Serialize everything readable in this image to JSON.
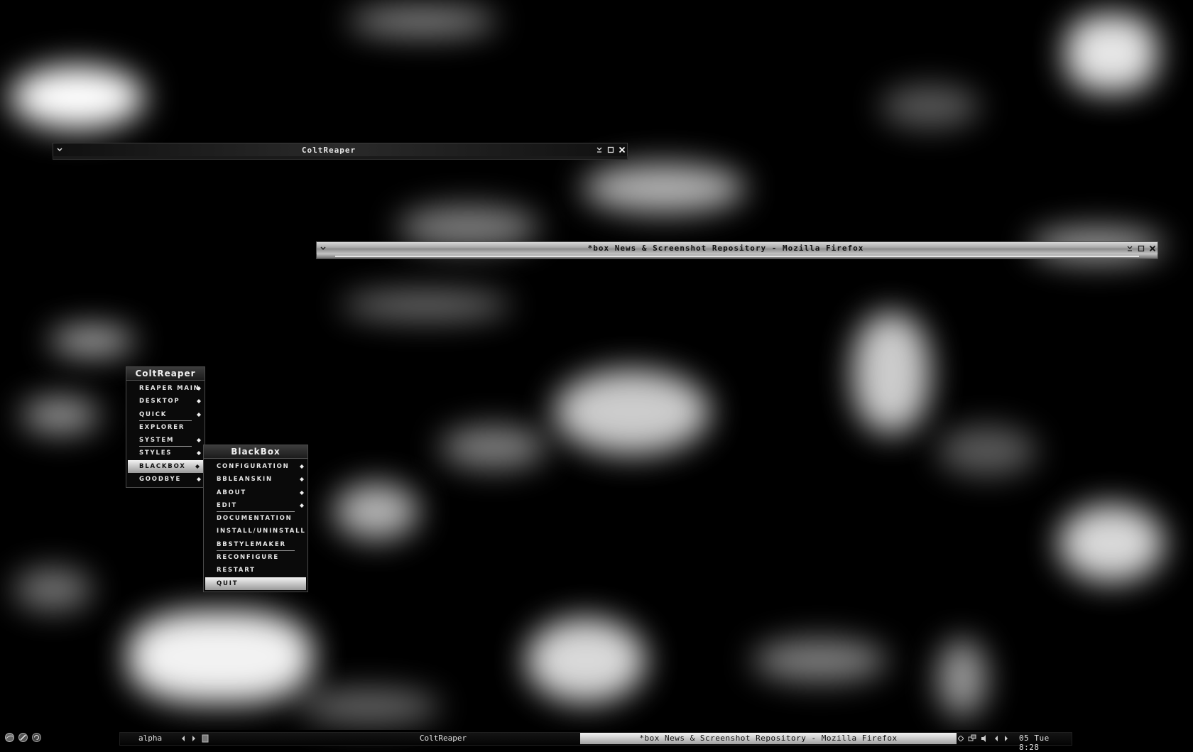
{
  "windows": [
    {
      "title": "ColtReaper"
    },
    {
      "title": "*box News & Screenshot Repository - Mozilla Firefox"
    }
  ],
  "root_menu": {
    "title": "ColtReaper",
    "items": [
      {
        "label": "REAPER MAIN",
        "submenu": true
      },
      {
        "label": "DESKTOP",
        "submenu": true
      },
      {
        "label": "QUICK",
        "submenu": true
      },
      {
        "label": "EXPLORER",
        "submenu": false
      },
      {
        "label": "SYSTEM",
        "submenu": true
      },
      {
        "label": "STYLES",
        "submenu": true
      },
      {
        "label": "BLACKBOX",
        "submenu": true,
        "selected": true
      },
      {
        "label": "GOODBYE",
        "submenu": true
      }
    ]
  },
  "blackbox_menu": {
    "title": "BlackBox",
    "items": [
      {
        "label": "CONFIGURATION",
        "submenu": true
      },
      {
        "label": "BBLEANSKIN",
        "submenu": true
      },
      {
        "label": "ABOUT",
        "submenu": true
      },
      {
        "label": "EDIT",
        "submenu": true
      },
      {
        "label": "DOCUMENTATION",
        "submenu": false
      },
      {
        "label": "INSTALL/UNINSTALL",
        "submenu": false
      },
      {
        "label": "BBSTYLEMAKER",
        "submenu": false
      },
      {
        "label": "RECONFIGURE",
        "submenu": false
      },
      {
        "label": "RESTART",
        "submenu": false
      },
      {
        "label": "QUIT",
        "submenu": false,
        "selected": true
      }
    ]
  },
  "taskbar": {
    "workspace": "alpha",
    "tasks": [
      {
        "label": "ColtReaper",
        "active": false
      },
      {
        "label": "*box News & Screenshot Repository - Mozilla Firefox",
        "active": true
      }
    ],
    "clock": "05 Tue 8:28"
  },
  "icons": {
    "tray_left": [
      "firefox-icon",
      "feather-icon",
      "spiral-icon"
    ],
    "tray_right": [
      "diamond-icon",
      "network-icon",
      "volume-icon",
      "arrow-left-icon",
      "arrow-right-icon"
    ]
  }
}
